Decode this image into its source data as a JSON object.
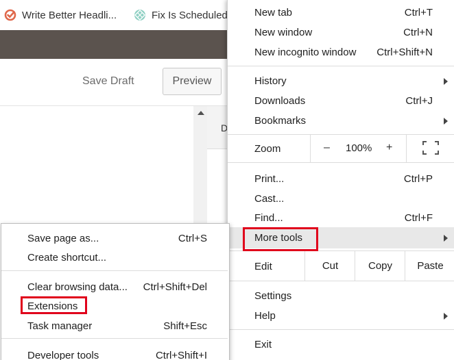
{
  "bookmarks": [
    {
      "label": "Write Better Headli...",
      "icon": "coschedule-check-icon"
    },
    {
      "label": "Fix Is Scheduled",
      "icon": "teal-diamond-icon"
    }
  ],
  "editor": {
    "save_draft": "Save Draft",
    "preview": "Preview",
    "side_panel_letter": "D"
  },
  "menu": {
    "new_tab": {
      "label": "New tab",
      "shortcut": "Ctrl+T"
    },
    "new_window": {
      "label": "New window",
      "shortcut": "Ctrl+N"
    },
    "new_incognito": {
      "label": "New incognito window",
      "shortcut": "Ctrl+Shift+N"
    },
    "history": {
      "label": "History"
    },
    "downloads": {
      "label": "Downloads",
      "shortcut": "Ctrl+J"
    },
    "bookmarks": {
      "label": "Bookmarks"
    },
    "zoom": {
      "label": "Zoom",
      "minus": "–",
      "value": "100%",
      "plus": "+"
    },
    "print": {
      "label": "Print...",
      "shortcut": "Ctrl+P"
    },
    "cast": {
      "label": "Cast..."
    },
    "find": {
      "label": "Find...",
      "shortcut": "Ctrl+F"
    },
    "more_tools": {
      "label": "More tools"
    },
    "edit": {
      "label": "Edit",
      "cut": "Cut",
      "copy": "Copy",
      "paste": "Paste"
    },
    "settings": {
      "label": "Settings"
    },
    "help": {
      "label": "Help"
    },
    "exit": {
      "label": "Exit"
    }
  },
  "submenu": {
    "save_page": {
      "label": "Save page as...",
      "shortcut": "Ctrl+S"
    },
    "create_shortcut": {
      "label": "Create shortcut..."
    },
    "clear_browsing": {
      "label": "Clear browsing data...",
      "shortcut": "Ctrl+Shift+Del"
    },
    "extensions": {
      "label": "Extensions"
    },
    "task_manager": {
      "label": "Task manager",
      "shortcut": "Shift+Esc"
    },
    "developer_tools": {
      "label": "Developer tools",
      "shortcut": "Ctrl+Shift+I"
    }
  },
  "colors": {
    "highlight_box": "#e0001b",
    "dark_band": "#5b534e",
    "menu_hover": "#e8e8e8"
  }
}
